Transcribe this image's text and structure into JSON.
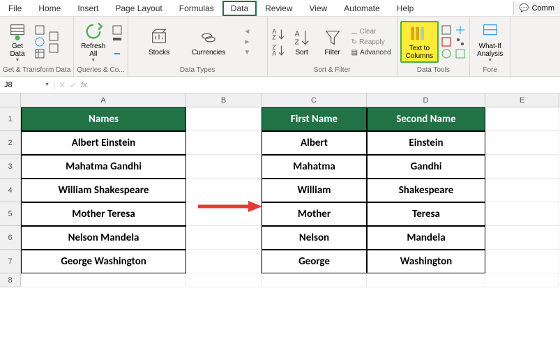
{
  "menubar": {
    "items": [
      "File",
      "Home",
      "Insert",
      "Page Layout",
      "Formulas",
      "Data",
      "Review",
      "View",
      "Automate",
      "Help"
    ],
    "active": "Data",
    "comments": "Comm"
  },
  "ribbon": {
    "get_data": "Get\nData",
    "group_transform": "Get & Transform Data",
    "refresh": "Refresh\nAll",
    "group_queries": "Queries & Co...",
    "stocks": "Stocks",
    "currencies": "Currencies",
    "group_datatypes": "Data Types",
    "sort": "Sort",
    "filter": "Filter",
    "clear": "Clear",
    "reapply": "Reapply",
    "advanced": "Advanced",
    "group_sortfilter": "Sort & Filter",
    "text_to_columns": "Text to\nColumns",
    "group_datatools": "Data Tools",
    "whatif": "What-If\nAnalysis",
    "group_forecast": "Fore"
  },
  "formula_bar": {
    "name_box": "J8",
    "fx": "fx"
  },
  "columns": [
    "A",
    "B",
    "C",
    "D",
    "E"
  ],
  "rows": [
    "1",
    "2",
    "3",
    "4",
    "5",
    "6",
    "7",
    "8"
  ],
  "headers": {
    "names": "Names",
    "first": "First Name",
    "second": "Second Name"
  },
  "data": {
    "names": [
      "Albert Einstein",
      "Mahatma Gandhi",
      "William Shakespeare",
      "Mother Teresa",
      "Nelson Mandela",
      "George Washington"
    ],
    "first": [
      "Albert",
      "Mahatma",
      "William",
      "Mother",
      "Nelson",
      "George"
    ],
    "second": [
      "Einstein",
      "Gandhi",
      "Shakespeare",
      "Teresa",
      "Mandela",
      "Washington"
    ]
  }
}
